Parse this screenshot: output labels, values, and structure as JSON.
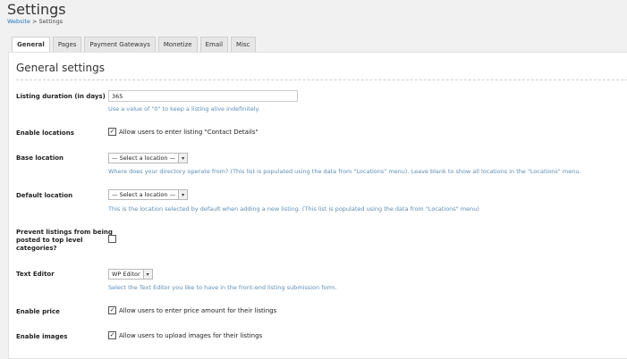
{
  "header": {
    "title": "Settings",
    "breadcrumb": {
      "link": "Website",
      "separator": " > ",
      "current": "Settings"
    }
  },
  "tabs": [
    {
      "label": "General",
      "active": true
    },
    {
      "label": "Pages"
    },
    {
      "label": "Payment Gateways"
    },
    {
      "label": "Monetize"
    },
    {
      "label": "Email"
    },
    {
      "label": "Misc"
    }
  ],
  "section_title": "General settings",
  "fields": {
    "listing_duration": {
      "label": "Listing duration (in days)",
      "value": "365",
      "help": "Use a value of \"0\" to keep a listing alive indefinitely."
    },
    "enable_locations": {
      "label": "Enable locations",
      "checkbox_label": "Allow users to enter listing \"Contact Details\"",
      "checked": true
    },
    "base_location": {
      "label": "Base location",
      "selected": "— Select a location —",
      "help": "Where does your directory operate from? (This list is populated using the data from \"Locations\" menu). Leave blank to show all locations in the \"Locations\" menu."
    },
    "default_location": {
      "label": "Default location",
      "selected": "— Select a location —",
      "help": "This is the location selected by default when adding a new listing. (This list is populated using the data from \"Locations\" menu)"
    },
    "prevent_top_level": {
      "label_line1": "Prevent listings from being",
      "label_line2": "posted to top level",
      "label_line3": "categories?",
      "checked": false
    },
    "text_editor": {
      "label": "Text Editor",
      "selected": "WP Editor",
      "help": "Select the Text Editor you like to have in the front-end listing submission form."
    },
    "enable_price": {
      "label": "Enable price",
      "checkbox_label": "Allow users to enter price amount for their listings",
      "checked": true
    },
    "enable_images": {
      "label": "Enable images",
      "checkbox_label": "Allow users to upload images for their listings",
      "checked": true
    }
  },
  "icons": {
    "check": "✓",
    "dropdown": "▾"
  }
}
